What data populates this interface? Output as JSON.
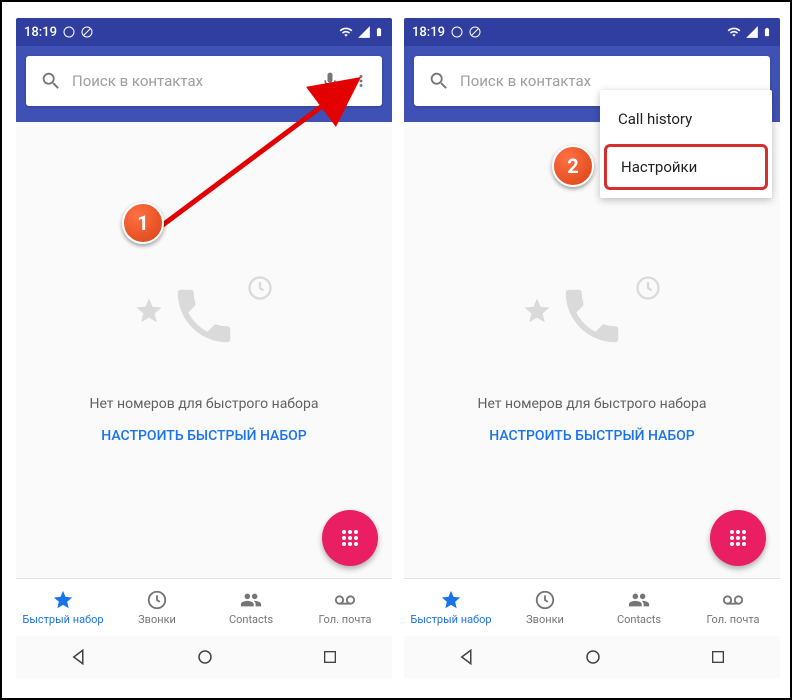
{
  "status": {
    "time": "18:19"
  },
  "search": {
    "placeholder": "Поиск в контактах"
  },
  "empty": {
    "message": "Нет номеров для быстрого набора",
    "action": "НАСТРОИТЬ БЫСТРЫЙ НАБОР"
  },
  "nav": {
    "speed_dial": "Быстрый набор",
    "calls": "Звонки",
    "contacts": "Contacts",
    "voicemail": "Гол. почта"
  },
  "menu": {
    "call_history": "Call history",
    "settings": "Настройки"
  },
  "badges": {
    "one": "1",
    "two": "2"
  }
}
